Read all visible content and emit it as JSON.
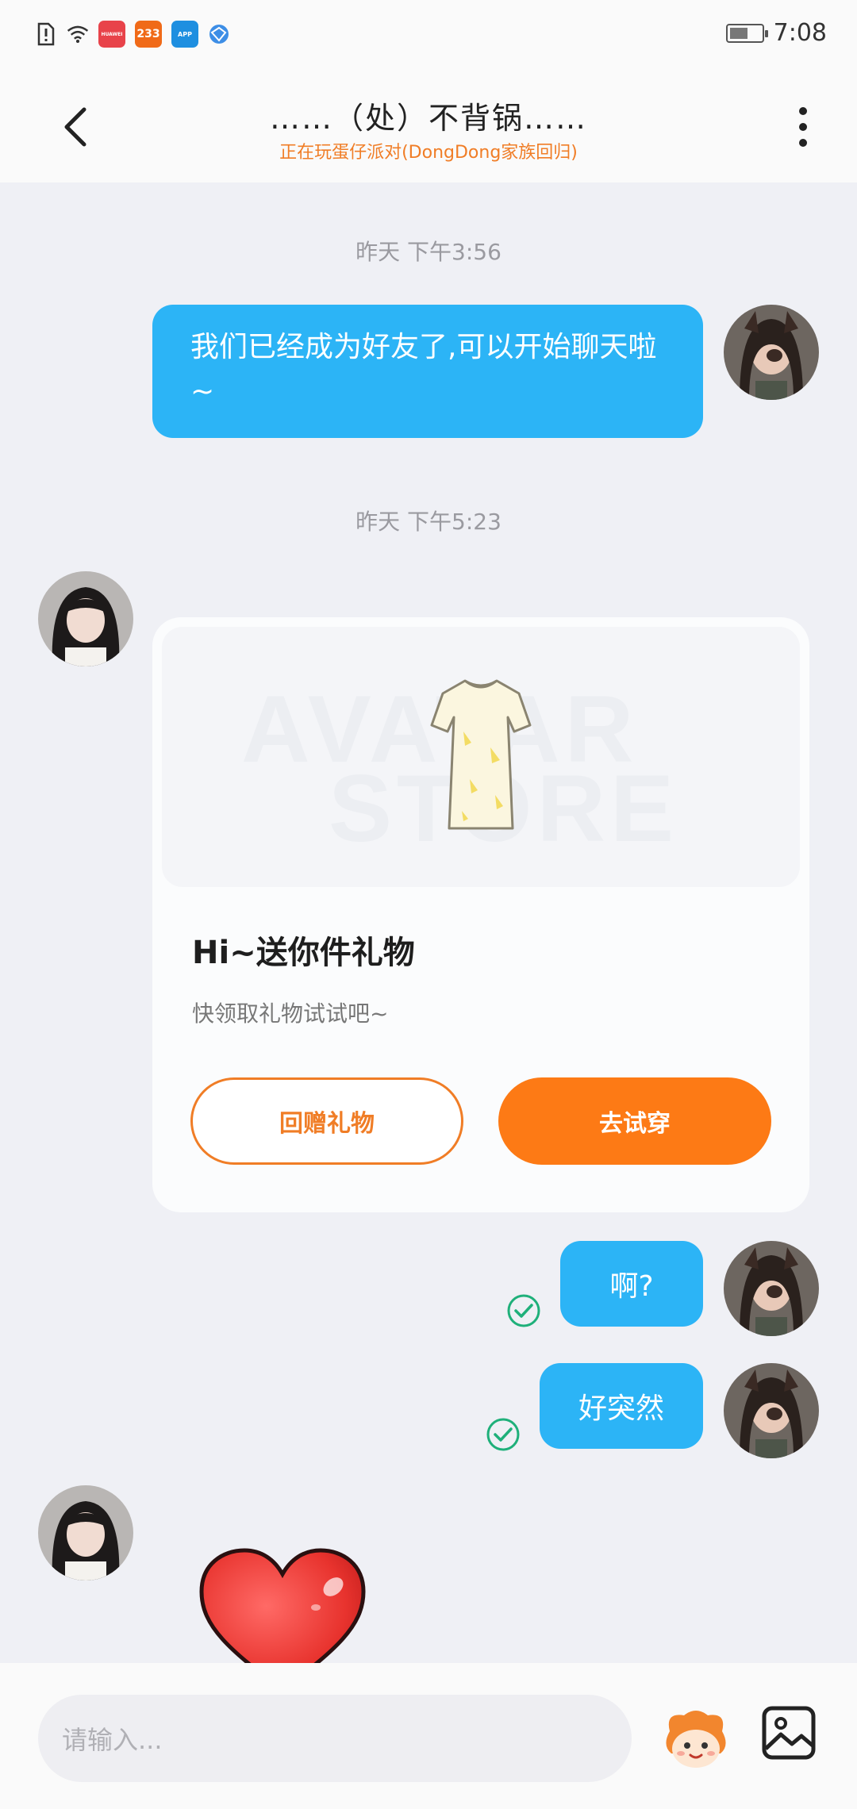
{
  "status_bar": {
    "time": "7:08",
    "apps": [
      {
        "name": "HUAWEI",
        "color": "#e8434a"
      },
      {
        "name": "233",
        "color": "#f06a18"
      },
      {
        "name": "APP",
        "color": "#1e8fe0"
      }
    ]
  },
  "header": {
    "title": "……（处）不背锅……",
    "subtitle": "正在玩蛋仔派对(DongDong家族回归)"
  },
  "messages": {
    "time1": "昨天 下午3:56",
    "msg1": "我们已经成为好友了,可以开始聊天啦~",
    "time2": "昨天 下午5:23",
    "gift": {
      "watermark_top": "AVATAR",
      "watermark_bottom": "STORE",
      "title": "Hi~送你件礼物",
      "subtitle": "快领取礼物试试吧~",
      "return_gift_label": "回赠礼物",
      "try_on_label": "去试穿"
    },
    "msg2": "啊?",
    "msg3": "好突然"
  },
  "input": {
    "placeholder": "请输入..."
  },
  "colors": {
    "accent_orange": "#fd7a15",
    "bubble_blue": "#2cb4f6",
    "check_green": "#1fb07a"
  }
}
